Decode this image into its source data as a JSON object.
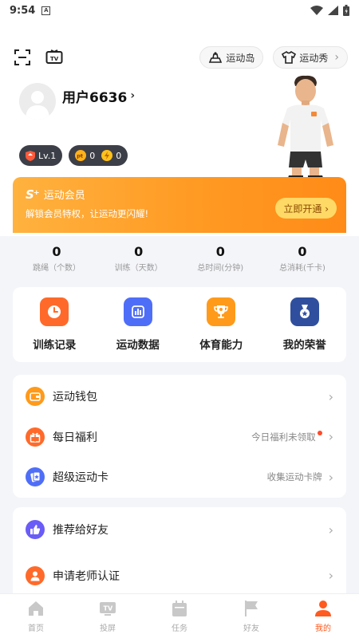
{
  "status_bar": {
    "time": "9:54",
    "notification": "A"
  },
  "topbar": {
    "island_label": "运动岛",
    "show_label": "运动秀"
  },
  "profile": {
    "username": "用户6636",
    "chevron": "›"
  },
  "badges": {
    "level": "Lv.1",
    "pt_label": "pt",
    "points": "0",
    "coins": "0"
  },
  "vip": {
    "logo": "S⁺",
    "title": "运动会员",
    "description": "解锁会员特权，让运动更闪耀!",
    "button_label": "立即开通 ›"
  },
  "stats": [
    {
      "value": "0",
      "label": "跳绳（个数）"
    },
    {
      "value": "0",
      "label": "训练（天数）"
    },
    {
      "value": "0",
      "label": "总时间(分钟)"
    },
    {
      "value": "0",
      "label": "总消耗(千卡)"
    }
  ],
  "features": [
    {
      "label": "训练记录",
      "icon": "clock-icon",
      "color": "#ff6a2a"
    },
    {
      "label": "运动数据",
      "icon": "bar-chart-icon",
      "color": "#4f6ef7"
    },
    {
      "label": "体育能力",
      "icon": "trophy-icon",
      "color": "#ff9a1a"
    },
    {
      "label": "我的荣誉",
      "icon": "medal-icon",
      "color": "#2f4f9e"
    }
  ],
  "list1": [
    {
      "label": "运动钱包",
      "right": "",
      "icon": "wallet-icon",
      "color": "#ff9a1a"
    },
    {
      "label": "每日福利",
      "right": "今日福利未领取",
      "icon": "gift-icon",
      "color": "#ff6a2a"
    },
    {
      "label": "超级运动卡",
      "right": "收集运动卡牌",
      "icon": "card-icon",
      "color": "#4f6ef7"
    }
  ],
  "list2": [
    {
      "label": "推荐给好友",
      "icon": "thumbs-up-icon",
      "color": "#6a5cf7"
    },
    {
      "label": "申请老师认证",
      "icon": "teacher-icon",
      "color": "#ff6a2a"
    }
  ],
  "bottom_nav": [
    {
      "label": "首页",
      "icon": "home-icon"
    },
    {
      "label": "投屏",
      "icon": "tv-icon"
    },
    {
      "label": "任务",
      "icon": "calendar-icon"
    },
    {
      "label": "好友",
      "icon": "flag-icon"
    },
    {
      "label": "我的",
      "icon": "person-icon",
      "active": true
    }
  ],
  "colors": {
    "accent": "#ff5a1f",
    "vip_gradient_start": "#ffb23f",
    "vip_gradient_end": "#ff8b17"
  }
}
